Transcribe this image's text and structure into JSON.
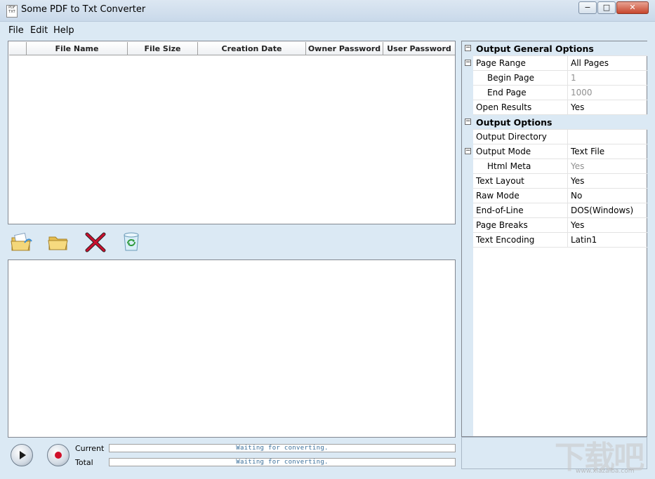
{
  "window": {
    "title": "Some PDF to Txt Converter",
    "icon_text": "PDF TXT",
    "minimize": "−",
    "maximize": "□",
    "close": "✕"
  },
  "menu": [
    {
      "label": "File"
    },
    {
      "label": "Edit"
    },
    {
      "label": "Help"
    }
  ],
  "file_table": {
    "columns": [
      "File Name",
      "File Size",
      "Creation Date",
      "Owner Password",
      "User Password"
    ],
    "rows": []
  },
  "toolbar": {
    "buttons": [
      {
        "name": "add-file-button",
        "icon": "open-file-icon"
      },
      {
        "name": "add-folder-button",
        "icon": "folder-icon"
      },
      {
        "name": "remove-button",
        "icon": "red-x-icon"
      },
      {
        "name": "clear-button",
        "icon": "recycle-bin-icon"
      }
    ]
  },
  "progress": {
    "current_label": "Current",
    "total_label": "Total",
    "current_status": "Waiting for converting.",
    "total_status": "Waiting for converting."
  },
  "properties": {
    "cat_general": "Output General Options",
    "page_range": {
      "name": "Page Range",
      "value": "All Pages"
    },
    "begin_page": {
      "name": "Begin Page",
      "value": "1"
    },
    "end_page": {
      "name": "End Page",
      "value": "1000"
    },
    "open_results": {
      "name": "Open Results",
      "value": "Yes"
    },
    "cat_output": "Output Options",
    "output_directory": {
      "name": "Output Directory",
      "value": ""
    },
    "output_mode": {
      "name": "Output Mode",
      "value": "Text File"
    },
    "html_meta": {
      "name": "Html Meta",
      "value": "Yes"
    },
    "text_layout": {
      "name": "Text Layout",
      "value": "Yes"
    },
    "raw_mode": {
      "name": "Raw Mode",
      "value": "No"
    },
    "end_of_line": {
      "name": "End-of-Line",
      "value": "DOS(Windows)"
    },
    "page_breaks": {
      "name": "Page Breaks",
      "value": "Yes"
    },
    "text_encoding": {
      "name": "Text Encoding",
      "value": "Latin1"
    }
  },
  "watermark": {
    "main": "下载吧",
    "sub": "www.xiazaiba.com"
  },
  "colors": {
    "chrome": "#dbe9f4",
    "accent_red": "#c8102e",
    "status_text": "#3a6f9a"
  }
}
